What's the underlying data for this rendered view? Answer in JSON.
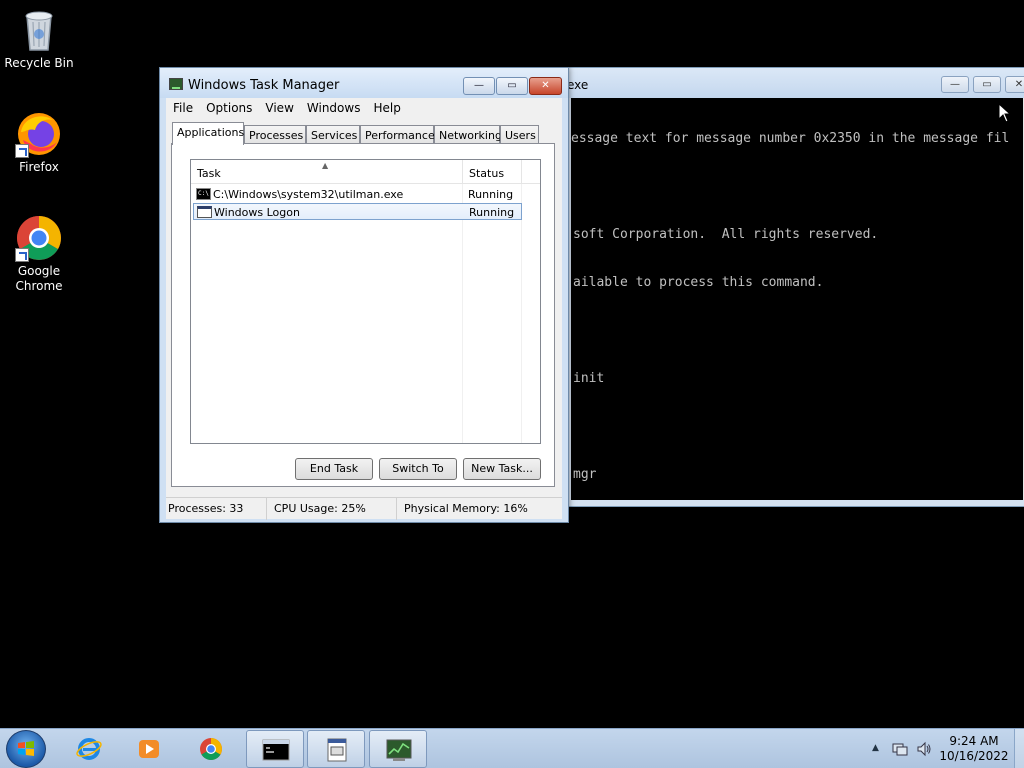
{
  "desktop": {
    "icons": [
      {
        "label": "Recycle Bin"
      },
      {
        "label": "Firefox"
      },
      {
        "label": "Google Chrome"
      }
    ]
  },
  "console": {
    "title_fragment": "exe",
    "lines": [
      "essage text for message number 0x2350 in the message fil",
      "",
      "soft Corporation.  All rights reserved.",
      "ailable to process this command.",
      "",
      "init",
      "",
      "mgr"
    ]
  },
  "task_manager": {
    "title": "Windows Task Manager",
    "window_buttons": {
      "minimize": "—",
      "maximize": "▭",
      "close": "✕"
    },
    "menu": [
      "File",
      "Options",
      "View",
      "Windows",
      "Help"
    ],
    "tabs": [
      "Applications",
      "Processes",
      "Services",
      "Performance",
      "Networking",
      "Users"
    ],
    "active_tab": "Applications",
    "columns": {
      "task": "Task",
      "status": "Status"
    },
    "rows": [
      {
        "task": "C:\\Windows\\system32\\utilman.exe",
        "status": "Running",
        "icon": "cmd-icon"
      },
      {
        "task": "Windows Logon",
        "status": "Running",
        "icon": "window-icon"
      }
    ],
    "buttons": {
      "end_task": "End Task",
      "switch_to": "Switch To",
      "new_task": "New Task..."
    },
    "status": {
      "processes": "Processes: 33",
      "cpu": "CPU Usage: 25%",
      "memory": "Physical Memory: 16%"
    }
  },
  "taskbar": {
    "pinned": [
      "internet-explorer-icon",
      "media-player-icon",
      "chrome-icon",
      "cmd-icon",
      "exe-window-icon",
      "task-manager-icon"
    ],
    "clock": {
      "time": "9:24 AM",
      "date": "10/16/2022"
    }
  },
  "colors": {
    "desktop_bg": "#000000",
    "title_glass": "#cfe0f3",
    "close_red": "#c7452b",
    "selection": "#7da2ce"
  }
}
